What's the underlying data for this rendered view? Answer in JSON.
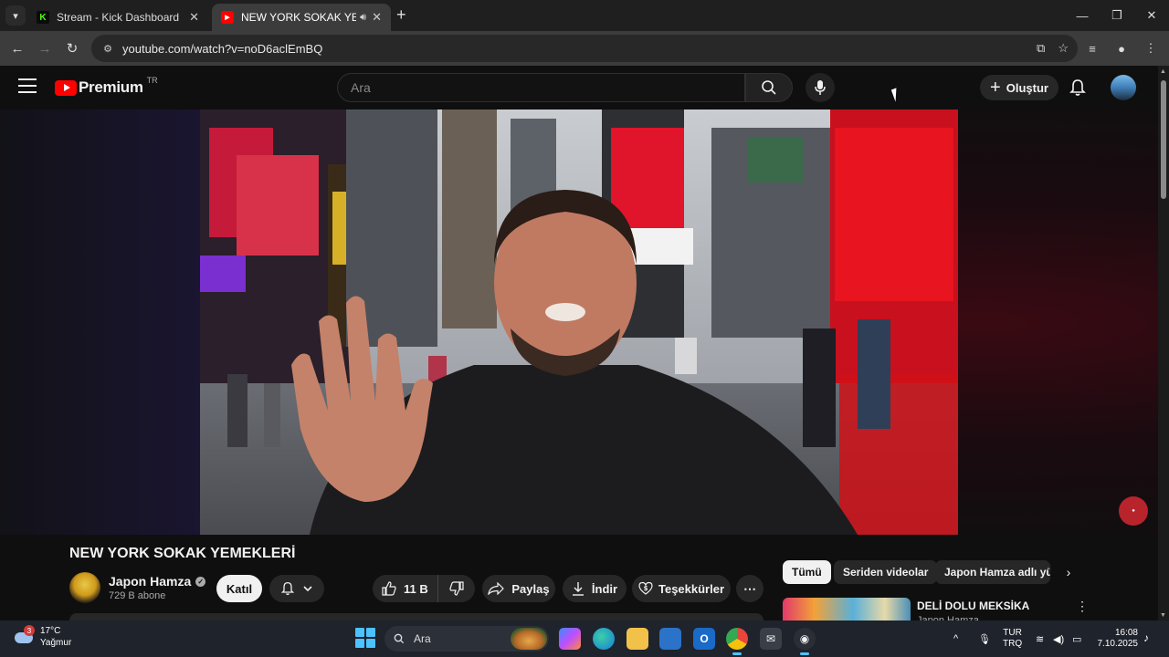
{
  "browser": {
    "tabs": [
      {
        "title": "Stream - Kick Dashboard",
        "favicon": "kick-icon",
        "active": false
      },
      {
        "title": "NEW YORK SOKAK YEMEKLERİ",
        "favicon": "youtube-icon",
        "active": true,
        "audio": true
      }
    ],
    "url": "youtube.com/watch?v=noD6aclEmBQ"
  },
  "youtube": {
    "logo_text": "Premium",
    "region": "TR",
    "search_placeholder": "Ara",
    "create_label": "Oluştur",
    "video": {
      "title": "NEW YORK SOKAK YEMEKLERİ",
      "channel": "Japon Hamza",
      "subscribers": "729 B abone",
      "join_label": "Katıl",
      "likes": "11 B",
      "share_label": "Paylaş",
      "download_label": "İndir",
      "thanks_label": "Teşekkürler",
      "more": "⋯"
    },
    "chips": [
      "Tümü",
      "Seriden videolar",
      "Japon Hamza adlı yükleyici"
    ],
    "recommendation": {
      "title": "DELİ DOLU MEKSİKA",
      "channel": "Japon Hamza"
    }
  },
  "taskbar": {
    "weather_temp": "17°C",
    "weather_desc": "Yağmur",
    "weather_badge": "3",
    "search_label": "Ara",
    "lang_top": "TUR",
    "lang_bottom": "TRQ",
    "time": "16:08",
    "date": "7.10.2025"
  },
  "colors": {
    "yt_red": "#ff0000",
    "accent_blue": "#4cc2ff",
    "kick_green": "#53fc18"
  }
}
